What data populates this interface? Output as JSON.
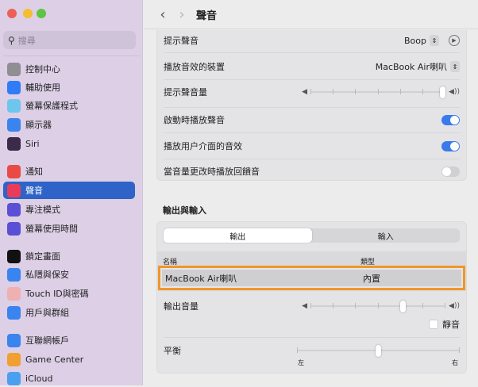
{
  "window": {
    "title": "聲音"
  },
  "sidebar": {
    "search_placeholder": "搜尋",
    "items": [
      {
        "label": "控制中心",
        "icon": "control-center-icon",
        "color": "#8e8e93"
      },
      {
        "label": "輔助使用",
        "icon": "accessibility-icon",
        "color": "#2f7cf6"
      },
      {
        "label": "螢幕保護程式",
        "icon": "screensaver-icon",
        "color": "#6ec6ee"
      },
      {
        "label": "顯示器",
        "icon": "display-icon",
        "color": "#3a84f0"
      },
      {
        "label": "Siri",
        "icon": "siri-icon",
        "color": "#3b2a4a"
      },
      {
        "label": "通知",
        "icon": "notifications-icon",
        "color": "#ea4a44"
      },
      {
        "label": "聲音",
        "icon": "sound-icon",
        "color": "#ea3c5a",
        "selected": true
      },
      {
        "label": "專注模式",
        "icon": "focus-icon",
        "color": "#5b4fd6"
      },
      {
        "label": "螢幕使用時間",
        "icon": "screen-time-icon",
        "color": "#5b4fd6"
      },
      {
        "label": "鎖定畫面",
        "icon": "lock-screen-icon",
        "color": "#111111"
      },
      {
        "label": "私隱與保安",
        "icon": "privacy-icon",
        "color": "#3a84f0"
      },
      {
        "label": "Touch ID與密碼",
        "icon": "touch-id-icon",
        "color": "#eeb0b0"
      },
      {
        "label": "用戶與群組",
        "icon": "users-icon",
        "color": "#3a84f0"
      },
      {
        "label": "互聯網帳戶",
        "icon": "internet-accounts-icon",
        "color": "#3a84f0"
      },
      {
        "label": "Game Center",
        "icon": "game-center-icon",
        "color": "#f0a030"
      },
      {
        "label": "iCloud",
        "icon": "icloud-icon",
        "color": "#4aa0ef"
      }
    ]
  },
  "settings": {
    "alert_sound": {
      "label": "提示聲音",
      "value": "Boop"
    },
    "play_device": {
      "label": "播放音效的裝置",
      "value": "MacBook Air喇叭"
    },
    "alert_volume": {
      "label": "提示聲音量",
      "value": 1.0
    },
    "startup_sound": {
      "label": "啟動時播放聲音",
      "on": true
    },
    "ui_sounds": {
      "label": "播放用户介面的音效",
      "on": true
    },
    "feedback": {
      "label": "當音量更改時播放回饋音",
      "on": false
    }
  },
  "io": {
    "section_title": "輸出與輸入",
    "tabs": [
      "輸出",
      "輸入"
    ],
    "active_tab": "輸出",
    "columns": {
      "name": "名稱",
      "type": "類型"
    },
    "devices": [
      {
        "name": "MacBook Air喇叭",
        "type": "內置"
      }
    ],
    "output_volume": {
      "label": "輸出音量",
      "value": 0.69
    },
    "mute": {
      "label": "靜音",
      "checked": false
    },
    "balance": {
      "label": "平衡",
      "value": 0.5,
      "left": "左",
      "right": "右"
    }
  },
  "colors": {
    "accent": "#3a7bec",
    "highlight": "#f0962a"
  }
}
